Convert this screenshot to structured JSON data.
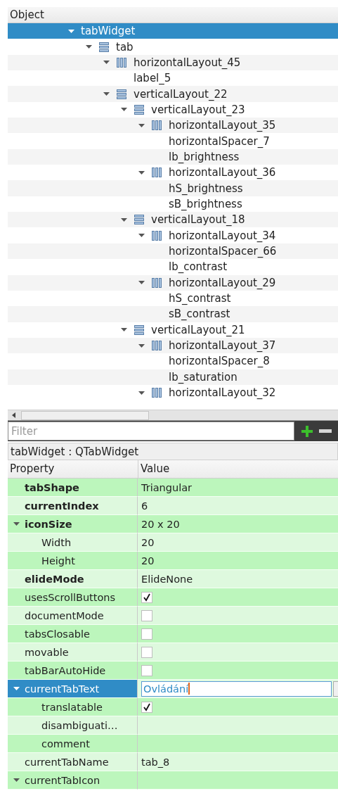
{
  "object_tree": {
    "header": "Object",
    "items": [
      {
        "name": "tabWidget",
        "expanded": true,
        "selected": true,
        "children": [
          {
            "name": "tab",
            "kind": "vertical",
            "expanded": true,
            "selected": false,
            "children": [
              {
                "name": "horizontalLayout_45",
                "kind": "horizontal",
                "expanded": true,
                "selected": false,
                "children": [
                  {
                    "name": "label_5",
                    "selected": false
                  }
                ]
              },
              {
                "name": "verticalLayout_22",
                "kind": "vertical",
                "expanded": true,
                "selected": false,
                "children": [
                  {
                    "name": "verticalLayout_23",
                    "kind": "vertical",
                    "expanded": true,
                    "selected": false,
                    "children": [
                      {
                        "name": "horizontalLayout_35",
                        "kind": "horizontal",
                        "expanded": true,
                        "selected": false,
                        "children": [
                          {
                            "name": "horizontalSpacer_7",
                            "selected": false
                          },
                          {
                            "name": "lb_brightness",
                            "selected": false
                          }
                        ]
                      },
                      {
                        "name": "horizontalLayout_36",
                        "kind": "horizontal",
                        "expanded": true,
                        "selected": false,
                        "children": [
                          {
                            "name": "hS_brightness",
                            "selected": false
                          },
                          {
                            "name": "sB_brightness",
                            "selected": false
                          }
                        ]
                      }
                    ]
                  },
                  {
                    "name": "verticalLayout_18",
                    "kind": "vertical",
                    "expanded": true,
                    "selected": false,
                    "children": [
                      {
                        "name": "horizontalLayout_34",
                        "kind": "horizontal",
                        "expanded": true,
                        "selected": false,
                        "children": [
                          {
                            "name": "horizontalSpacer_66",
                            "selected": false
                          },
                          {
                            "name": "lb_contrast",
                            "selected": false
                          }
                        ]
                      },
                      {
                        "name": "horizontalLayout_29",
                        "kind": "horizontal",
                        "expanded": true,
                        "selected": false,
                        "children": [
                          {
                            "name": "hS_contrast",
                            "selected": false
                          },
                          {
                            "name": "sB_contrast",
                            "selected": false
                          }
                        ]
                      }
                    ]
                  },
                  {
                    "name": "verticalLayout_21",
                    "kind": "vertical",
                    "expanded": true,
                    "selected": false,
                    "children": [
                      {
                        "name": "horizontalLayout_37",
                        "kind": "horizontal",
                        "expanded": true,
                        "selected": false,
                        "children": [
                          {
                            "name": "horizontalSpacer_8",
                            "selected": false
                          },
                          {
                            "name": "lb_saturation",
                            "selected": false
                          }
                        ]
                      },
                      {
                        "name": "horizontalLayout_32",
                        "kind": "horizontal",
                        "expanded": true,
                        "selected": false
                      }
                    ]
                  }
                ]
              }
            ]
          }
        ]
      }
    ]
  },
  "filter": {
    "placeholder": "Filter"
  },
  "class_label": "tabWidget : QTabWidget",
  "property_table": {
    "columns": [
      "Property",
      "Value"
    ],
    "rows": [
      {
        "name": "tabShape",
        "modified": true,
        "selected": false,
        "kind": "text",
        "value": "Triangular"
      },
      {
        "name": "currentIndex",
        "modified": true,
        "selected": false,
        "kind": "text",
        "value": "6"
      },
      {
        "name": "iconSize",
        "modified": true,
        "selected": false,
        "kind": "text",
        "value": "20 x 20",
        "expanded": true,
        "children": [
          {
            "name": "Width",
            "modified": false,
            "selected": false,
            "kind": "text",
            "value": "20"
          },
          {
            "name": "Height",
            "modified": false,
            "selected": false,
            "kind": "text",
            "value": "20"
          }
        ]
      },
      {
        "name": "elideMode",
        "modified": true,
        "selected": false,
        "kind": "text",
        "value": "ElideNone"
      },
      {
        "name": "usesScrollButtons",
        "modified": false,
        "selected": false,
        "kind": "checkbox",
        "checked": true
      },
      {
        "name": "documentMode",
        "modified": false,
        "selected": false,
        "kind": "checkbox",
        "checked": false
      },
      {
        "name": "tabsClosable",
        "modified": false,
        "selected": false,
        "kind": "checkbox",
        "checked": false
      },
      {
        "name": "movable",
        "modified": false,
        "selected": false,
        "kind": "checkbox",
        "checked": false
      },
      {
        "name": "tabBarAutoHide",
        "modified": false,
        "selected": false,
        "kind": "checkbox",
        "checked": false
      },
      {
        "name": "currentTabText",
        "modified": false,
        "selected": true,
        "kind": "edit",
        "value": "Ovládání",
        "expanded": true,
        "children": [
          {
            "name": "translatable",
            "modified": false,
            "selected": false,
            "kind": "checkbox",
            "checked": true
          },
          {
            "name": "disambiguati…",
            "modified": false,
            "selected": false,
            "kind": "empty"
          },
          {
            "name": "comment",
            "modified": false,
            "selected": false,
            "kind": "empty"
          }
        ]
      },
      {
        "name": "currentTabName",
        "modified": false,
        "selected": false,
        "kind": "text",
        "value": "tab_8"
      },
      {
        "name": "currentTabIcon",
        "modified": false,
        "selected": false,
        "kind": "empty",
        "expanded": true
      }
    ]
  }
}
